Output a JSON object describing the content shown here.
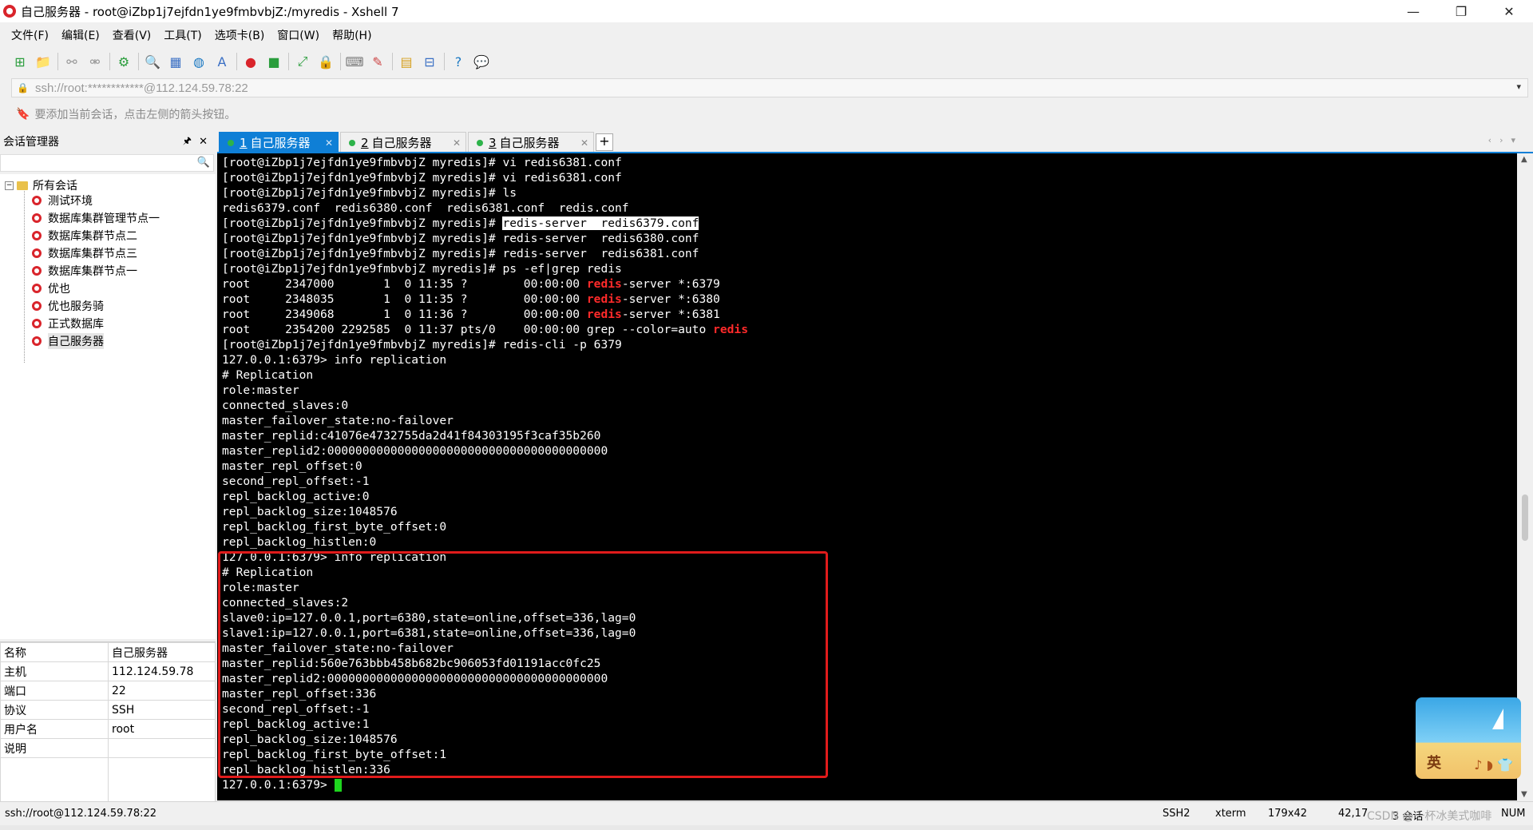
{
  "window": {
    "title": "自己服务器 - root@iZbp1j7ejfdn1ye9fmbvbjZ:/myredis - Xshell 7",
    "minimize": "—",
    "restore": "❐",
    "close": "✕"
  },
  "menu": [
    "文件(F)",
    "编辑(E)",
    "查看(V)",
    "工具(T)",
    "选项卡(B)",
    "窗口(W)",
    "帮助(H)"
  ],
  "address": {
    "value": "ssh://root:************@112.124.59.78:22",
    "dropdown": "▾"
  },
  "hint": "要添加当前会话，点击左侧的箭头按钮。",
  "session_panel": {
    "title": "会话管理器",
    "pin": "🖈",
    "close": "✕",
    "root": "所有会话",
    "items": [
      "测试环境",
      "数据库集群管理节点一",
      "数据库集群节点二",
      "数据库集群节点三",
      "数据库集群节点一",
      "优也",
      "优也服务骑",
      "正式数据库",
      "自己服务器"
    ]
  },
  "properties": [
    {
      "key": "名称",
      "value": "自己服务器"
    },
    {
      "key": "主机",
      "value": "112.124.59.78"
    },
    {
      "key": "端口",
      "value": "22"
    },
    {
      "key": "协议",
      "value": "SSH"
    },
    {
      "key": "用户名",
      "value": "root"
    },
    {
      "key": "说明",
      "value": ""
    }
  ],
  "tabs": [
    {
      "num": "1",
      "label": "自己服务器"
    },
    {
      "num": "2",
      "label": "自己服务器"
    },
    {
      "num": "3",
      "label": "自己服务器"
    }
  ],
  "tab_add": "+",
  "terminal": {
    "lines": [
      "[root@iZbp1j7ejfdn1ye9fmbvbjZ myredis]# vi redis6381.conf",
      "[root@iZbp1j7ejfdn1ye9fmbvbjZ myredis]# vi redis6381.conf",
      "[root@iZbp1j7ejfdn1ye9fmbvbjZ myredis]# ls",
      "redis6379.conf  redis6380.conf  redis6381.conf  redis.conf",
      "[root@iZbp1j7ejfdn1ye9fmbvbjZ myredis]# ",
      "[root@iZbp1j7ejfdn1ye9fmbvbjZ myredis]# redis-server  redis6380.conf",
      "[root@iZbp1j7ejfdn1ye9fmbvbjZ myredis]# redis-server  redis6381.conf",
      "[root@iZbp1j7ejfdn1ye9fmbvbjZ myredis]# ps -ef|grep redis",
      "root     2347000       1  0 11:35 ?        00:00:00 ",
      "root     2348035       1  0 11:35 ?        00:00:00 ",
      "root     2349068       1  0 11:36 ?        00:00:00 ",
      "root     2354200 2292585  0 11:37 pts/0    00:00:00 grep --color=auto ",
      "[root@iZbp1j7ejfdn1ye9fmbvbjZ myredis]# redis-cli -p 6379",
      "127.0.0.1:6379> info replication",
      "# Replication",
      "role:master",
      "connected_slaves:0",
      "master_failover_state:no-failover",
      "master_replid:c41076e4732755da2d41f84303195f3caf35b260",
      "master_replid2:0000000000000000000000000000000000000000",
      "master_repl_offset:0",
      "second_repl_offset:-1",
      "repl_backlog_active:0",
      "repl_backlog_size:1048576",
      "repl_backlog_first_byte_offset:0",
      "repl_backlog_histlen:0",
      "127.0.0.1:6379> info replication",
      "# Replication",
      "role:master",
      "connected_slaves:2",
      "slave0:ip=127.0.0.1,port=6380,state=online,offset=336,lag=0",
      "slave1:ip=127.0.0.1,port=6381,state=online,offset=336,lag=0",
      "master_failover_state:no-failover",
      "master_replid:560e763bbb458b682bc906053fd01191acc0fc25",
      "master_replid2:0000000000000000000000000000000000000000",
      "master_repl_offset:336",
      "second_repl_offset:-1",
      "repl_backlog_active:1",
      "repl_backlog_size:1048576",
      "repl_backlog_first_byte_offset:1",
      "repl_backlog_histlen:336",
      "127.0.0.1:6379> "
    ],
    "selected_command": "redis-server  redis6379.conf",
    "redis_word": "redis",
    "server_suffix": "-server *:",
    "ports": [
      "6379",
      "6380",
      "6381"
    ]
  },
  "widget": {
    "lang": "英",
    "tray": "♪ ◗ 👕"
  },
  "status": {
    "address": "ssh://root@112.124.59.78:22",
    "protocol": "SSH2",
    "term": "xterm",
    "size": "179x42",
    "position": "42,17",
    "sessions": "3 会话",
    "watermark": "CSDN @一杯冰美式咖啡",
    "num": "NUM"
  },
  "colors": {
    "accent": "#0f7fd6",
    "highlight_red": "#e01b1b",
    "grep_match": "#ff2a2a",
    "cursor": "#1ed51e"
  }
}
